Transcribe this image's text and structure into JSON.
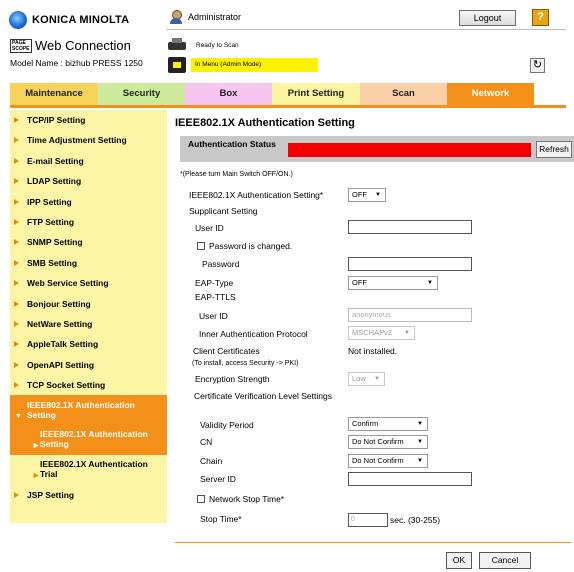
{
  "header": {
    "brand": "KONICA MINOLTA",
    "product_mark": "PAGE SCOPE",
    "product_name": "Web Connection",
    "model": "Model Name : bizhub PRESS 1250",
    "user": "Administrator",
    "logout_label": "Logout",
    "help_label": "?",
    "device_status": "Ready to Scan",
    "mode_status": "In Menu (Admin Mode)",
    "refresh_icon": "↻"
  },
  "tabs": [
    {
      "label": "Maintenance",
      "color": "#f7d35a"
    },
    {
      "label": "Security",
      "color": "#cdeb9a"
    },
    {
      "label": "Box",
      "color": "#f6c6f0"
    },
    {
      "label": "Print Setting",
      "color": "#fbf5a2"
    },
    {
      "label": "Scan",
      "color": "#fcd0a6"
    },
    {
      "label": "Network",
      "color": "#f39019",
      "active": true
    }
  ],
  "sidebar": {
    "items": [
      "TCP/IP Setting",
      "Time Adjustment Setting",
      "E-mail Setting",
      "LDAP Setting",
      "IPP Setting",
      "FTP Setting",
      "SNMP Setting",
      "SMB Setting",
      "Web Service Setting",
      "Bonjour Setting",
      "NetWare Setting",
      "AppleTalk Setting",
      "OpenAPI Setting",
      "TCP Socket Setting"
    ],
    "expanded": "IEEE802.1X Authentication Setting",
    "sub_active": "IEEE802.1X Authentication Setting",
    "sub_other": "IEEE802.1X Authentication Trial",
    "last": "JSP Setting"
  },
  "main": {
    "title": "IEEE802.1X Authentication Setting",
    "auth_status_label": "Authentication Status",
    "refresh_label": "Refresh",
    "note": "*(Please turn Main Switch OFF/ON.)",
    "setting_label": "IEEE802.1X Authentication Setting*",
    "setting_value": "OFF",
    "supplicant_label": "Supplicant Setting",
    "user_id_label": "User ID",
    "password_changed_label": "Password is changed.",
    "password_label": "Password",
    "eap_type_label": "EAP-Type",
    "eap_type_value": "OFF",
    "eap_ttls_label": "EAP-TTLS",
    "ttls_user_id_label": "User ID",
    "ttls_user_id_value": "anonymous",
    "inner_auth_label": "Inner Authentication Protocol",
    "inner_auth_value": "MSCHAPv2",
    "client_cert_label": "Client Certificates",
    "client_cert_value": "Not installed.",
    "client_cert_hint": "(To install, access Security -> PKI)",
    "encryption_label": "Encryption Strength",
    "encryption_value": "Low",
    "cert_verify_label": "Certificate Verification Level Settings",
    "validity_label": "Validity Period",
    "validity_value": "Confirm",
    "cn_label": "CN",
    "cn_value": "Do Not Confirm",
    "chain_label": "Chain",
    "chain_value": "Do Not Confirm",
    "server_id_label": "Server ID",
    "network_stop_label": "Network Stop Time*",
    "stop_time_label": "Stop Time*",
    "stop_time_value": "0",
    "stop_time_unit": "sec. (30-255)",
    "ok_label": "OK",
    "cancel_label": "Cancel"
  }
}
